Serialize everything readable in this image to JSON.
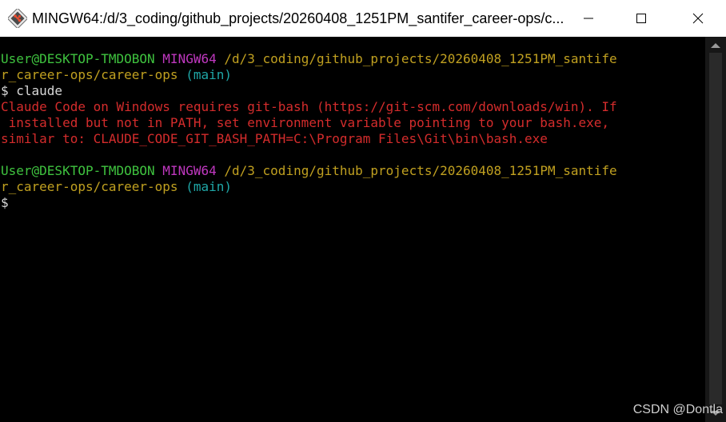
{
  "window": {
    "title": "MINGW64:/d/3_coding/github_projects/20260408_1251PM_santifer_career-ops/c...",
    "icon": "git-bash-icon",
    "controls": {
      "minimize": "minimize-icon",
      "maximize": "maximize-icon",
      "close": "close-icon"
    }
  },
  "terminal": {
    "prompt1": {
      "user": "User@DESKTOP-TMDOBON",
      "env": "MINGW64",
      "path_part1": "/d/3_coding/github_projects/20260408_1251PM_santife",
      "path_part2": "r_career-ops/career-ops",
      "branch": "(main)"
    },
    "command": "$ claude",
    "error_lines": [
      "Claude Code on Windows requires git-bash (https://git-scm.com/downloads/win). If",
      " installed but not in PATH, set environment variable pointing to your bash.exe,",
      "similar to: CLAUDE_CODE_GIT_BASH_PATH=C:\\Program Files\\Git\\bin\\bash.exe"
    ],
    "prompt2": {
      "user": "User@DESKTOP-TMDOBON",
      "env": "MINGW64",
      "path_part1": "/d/3_coding/github_projects/20260408_1251PM_santife",
      "path_part2": "r_career-ops/career-ops",
      "branch": "(main)"
    },
    "cursor_prompt": "$"
  },
  "watermark": "CSDN @Dontla",
  "colors": {
    "user": "#3fc33f",
    "env": "#c038c0",
    "path": "#c0a020",
    "branch": "#1fa7a7",
    "error": "#d42c2c",
    "text": "#d8d8d8"
  }
}
